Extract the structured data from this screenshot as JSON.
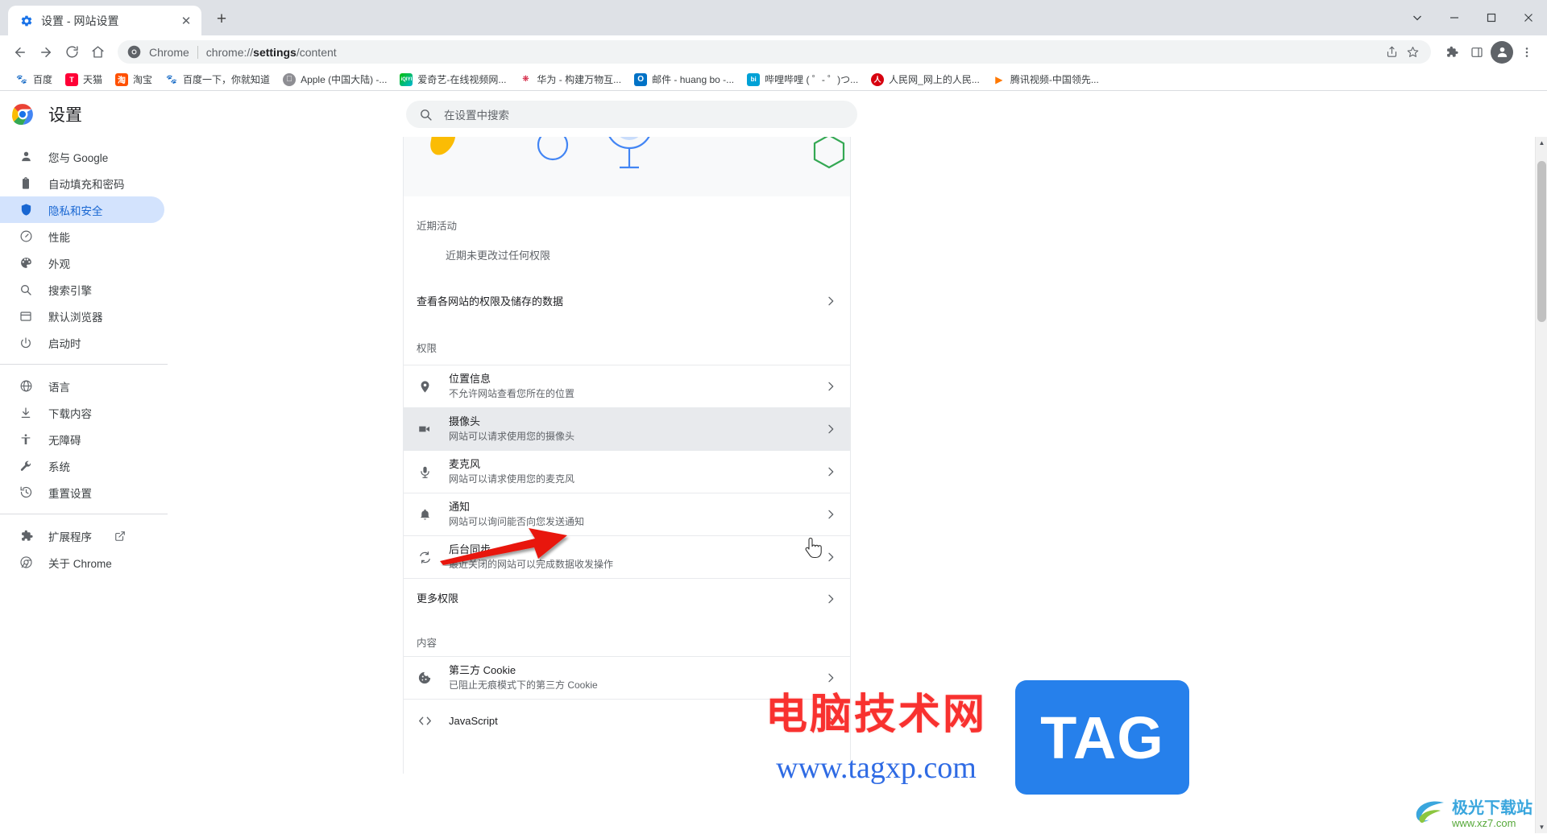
{
  "window": {
    "tab_title": "设置 - 网站设置",
    "tab_favicon": "settings-gear-icon",
    "new_tab_label": "+",
    "close_tab_label": "✕",
    "controls": {
      "list_all_tabs": "chevron-down-icon",
      "minimize": "minimize-icon",
      "maximize": "maximize-icon",
      "close": "close-icon"
    }
  },
  "toolbar": {
    "back": "back-arrow-icon",
    "forward": "forward-arrow-icon",
    "reload": "reload-icon",
    "home": "home-icon",
    "omnibox": {
      "chip_label": "Chrome",
      "url_prefix": "chrome://",
      "url_bold": "settings",
      "url_suffix": "/content"
    },
    "share": "share-icon",
    "bookmark_star": "star-icon",
    "extensions": "puzzle-icon",
    "side_panel": "side-panel-icon",
    "profile": "avatar-icon",
    "menu": "three-dot-menu-icon"
  },
  "bookmarks": [
    {
      "label": "百度",
      "icon": "baidu",
      "color": "#2932e1",
      "glyph": "🐾"
    },
    {
      "label": "天猫",
      "icon": "tmall",
      "color": "#ff0036",
      "glyph": "T"
    },
    {
      "label": "淘宝",
      "icon": "taobao",
      "color": "#ff5000",
      "glyph": "淘"
    },
    {
      "label": "百度一下，你就知道",
      "icon": "baidu",
      "color": "#2932e1",
      "glyph": "🐾"
    },
    {
      "label": "Apple (中国大陆) -...",
      "icon": "apple",
      "color": "#8e8e93",
      "glyph": ""
    },
    {
      "label": "爱奇艺-在线视频网...",
      "icon": "iqiyi",
      "color": "#00be06",
      "glyph": "iQIYI"
    },
    {
      "label": "华为 - 构建万物互...",
      "icon": "huawei",
      "color": "#cf0a2c",
      "glyph": "华"
    },
    {
      "label": "邮件 - huang bo -...",
      "icon": "outlook",
      "color": "#0072c6",
      "glyph": "O"
    },
    {
      "label": "哔哩哔哩 ( ゜- ゜)つ...",
      "icon": "bilibili",
      "color": "#00a1d6",
      "glyph": "bi"
    },
    {
      "label": "人民网_网上的人民...",
      "icon": "people",
      "color": "#d7000f",
      "glyph": "人"
    },
    {
      "label": "腾讯视频-中国领先...",
      "icon": "tencent",
      "color": "#ff7800",
      "glyph": "▶"
    }
  ],
  "settings": {
    "app_title": "设置",
    "logo": "chrome-logo-icon",
    "search": {
      "placeholder": "在设置中搜索",
      "icon": "search-icon"
    },
    "sidebar": {
      "groups": [
        {
          "items": [
            {
              "label": "您与 Google",
              "icon": "person-icon",
              "active": false
            },
            {
              "label": "自动填充和密码",
              "icon": "clipboard-icon",
              "active": false
            },
            {
              "label": "隐私和安全",
              "icon": "shield-icon",
              "active": true
            },
            {
              "label": "性能",
              "icon": "speedometer-icon",
              "active": false
            },
            {
              "label": "外观",
              "icon": "palette-icon",
              "active": false
            },
            {
              "label": "搜索引擎",
              "icon": "search-icon",
              "active": false
            },
            {
              "label": "默认浏览器",
              "icon": "browser-window-icon",
              "active": false
            },
            {
              "label": "启动时",
              "icon": "power-icon",
              "active": false
            }
          ]
        },
        {
          "items": [
            {
              "label": "语言",
              "icon": "globe-icon",
              "active": false
            },
            {
              "label": "下载内容",
              "icon": "download-icon",
              "active": false
            },
            {
              "label": "无障碍",
              "icon": "accessibility-icon",
              "active": false
            },
            {
              "label": "系统",
              "icon": "wrench-icon",
              "active": false
            },
            {
              "label": "重置设置",
              "icon": "history-restore-icon",
              "active": false
            }
          ]
        },
        {
          "items": [
            {
              "label": "扩展程序",
              "icon": "puzzle-icon",
              "active": false,
              "external": true
            },
            {
              "label": "关于 Chrome",
              "icon": "chrome-icon",
              "active": false
            }
          ]
        }
      ]
    },
    "content": {
      "recent_activity_label": "近期活动",
      "recent_activity_empty": "近期未更改过任何权限",
      "view_sites_row": {
        "title": "查看各网站的权限及储存的数据",
        "chevron": "chevron-right-icon"
      },
      "permissions_label": "权限",
      "permissions": [
        {
          "icon": "location-pin-icon",
          "title": "位置信息",
          "subtitle": "不允许网站查看您所在的位置",
          "hover": false
        },
        {
          "icon": "camera-icon",
          "title": "摄像头",
          "subtitle": "网站可以请求使用您的摄像头",
          "hover": true
        },
        {
          "icon": "microphone-icon",
          "title": "麦克风",
          "subtitle": "网站可以请求使用您的麦克风",
          "hover": false
        },
        {
          "icon": "bell-icon",
          "title": "通知",
          "subtitle": "网站可以询问能否向您发送通知",
          "hover": false
        },
        {
          "icon": "sync-icon",
          "title": "后台同步",
          "subtitle": "最近关闭的网站可以完成数据收发操作",
          "hover": false
        }
      ],
      "more_permissions_row": {
        "title": "更多权限",
        "chevron": "chevron-right-icon"
      },
      "content_label": "内容",
      "content_items": [
        {
          "icon": "cookie-icon",
          "title": "第三方 Cookie",
          "subtitle": "已阻止无痕模式下的第三方 Cookie"
        },
        {
          "icon": "code-icon",
          "title": "JavaScript",
          "subtitle": ""
        }
      ]
    }
  },
  "watermarks": {
    "main_cn": "电脑技术网",
    "main_url": "www.tagxp.com",
    "tag_badge": "TAG",
    "bottom_right_cn": "极光下载站",
    "bottom_right_url": "www.xz7.com"
  },
  "colors": {
    "accent_blue": "#1967d2",
    "active_bg": "#d3e3fd",
    "hover_bg": "#e8eaed",
    "arrow_red": "#e8140b"
  }
}
